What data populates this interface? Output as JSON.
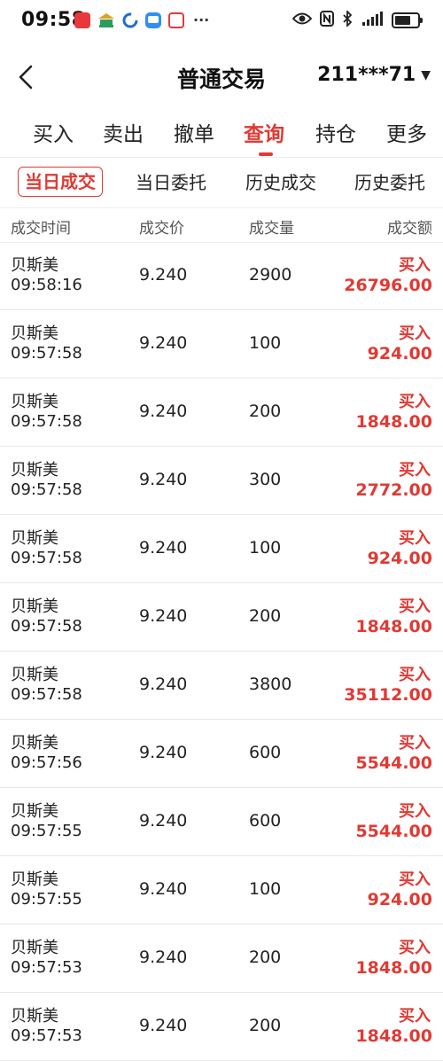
{
  "status_bar": {
    "time": "09:58",
    "notification_icons": [
      "red-app-icon",
      "bank-icon",
      "blue-c-icon",
      "chat-bubble-icon",
      "red-box-icon"
    ],
    "more": "···",
    "system_icons": [
      "eye-icon",
      "nfc-icon",
      "bluetooth-icon",
      "signal-icon",
      "battery-icon"
    ]
  },
  "header": {
    "title": "普通交易",
    "account": "211***71",
    "account_caret": "▼"
  },
  "main_tabs": [
    {
      "label": "买入",
      "active": false
    },
    {
      "label": "卖出",
      "active": false
    },
    {
      "label": "撤单",
      "active": false
    },
    {
      "label": "查询",
      "active": true
    },
    {
      "label": "持仓",
      "active": false
    },
    {
      "label": "更多",
      "active": false
    }
  ],
  "sub_tabs": [
    {
      "label": "当日成交",
      "active": true
    },
    {
      "label": "当日委托",
      "active": false
    },
    {
      "label": "历史成交",
      "active": false
    },
    {
      "label": "历史委托",
      "active": false
    }
  ],
  "table": {
    "columns": [
      "成交时间",
      "成交价",
      "成交量",
      "成交额"
    ],
    "rows": [
      {
        "name": "贝斯美",
        "time": "09:58:16",
        "price": "9.240",
        "volume": "2900",
        "side": "买入",
        "amount": "26796.00"
      },
      {
        "name": "贝斯美",
        "time": "09:57:58",
        "price": "9.240",
        "volume": "100",
        "side": "买入",
        "amount": "924.00"
      },
      {
        "name": "贝斯美",
        "time": "09:57:58",
        "price": "9.240",
        "volume": "200",
        "side": "买入",
        "amount": "1848.00"
      },
      {
        "name": "贝斯美",
        "time": "09:57:58",
        "price": "9.240",
        "volume": "300",
        "side": "买入",
        "amount": "2772.00"
      },
      {
        "name": "贝斯美",
        "time": "09:57:58",
        "price": "9.240",
        "volume": "100",
        "side": "买入",
        "amount": "924.00"
      },
      {
        "name": "贝斯美",
        "time": "09:57:58",
        "price": "9.240",
        "volume": "200",
        "side": "买入",
        "amount": "1848.00"
      },
      {
        "name": "贝斯美",
        "time": "09:57:58",
        "price": "9.240",
        "volume": "3800",
        "side": "买入",
        "amount": "35112.00"
      },
      {
        "name": "贝斯美",
        "time": "09:57:56",
        "price": "9.240",
        "volume": "600",
        "side": "买入",
        "amount": "5544.00"
      },
      {
        "name": "贝斯美",
        "time": "09:57:55",
        "price": "9.240",
        "volume": "600",
        "side": "买入",
        "amount": "5544.00"
      },
      {
        "name": "贝斯美",
        "time": "09:57:55",
        "price": "9.240",
        "volume": "100",
        "side": "买入",
        "amount": "924.00"
      },
      {
        "name": "贝斯美",
        "time": "09:57:53",
        "price": "9.240",
        "volume": "200",
        "side": "买入",
        "amount": "1848.00"
      },
      {
        "name": "贝斯美",
        "time": "09:57:53",
        "price": "9.240",
        "volume": "200",
        "side": "买入",
        "amount": "1848.00"
      }
    ]
  },
  "colors": {
    "accent": "#e03a34",
    "text": "#222222",
    "muted": "#555555",
    "divider": "#eeeeee"
  }
}
